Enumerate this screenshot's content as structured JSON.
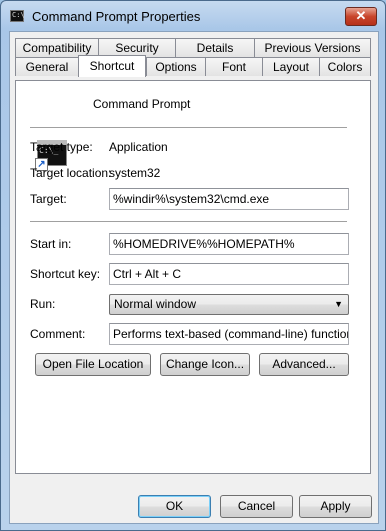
{
  "window": {
    "title": "Command Prompt Properties",
    "close_symbol": "✕"
  },
  "tabs": {
    "row1": [
      "Compatibility",
      "Security",
      "Details",
      "Previous Versions"
    ],
    "row2": [
      "General",
      "Shortcut",
      "Options",
      "Font",
      "Layout",
      "Colors"
    ],
    "active": "Shortcut"
  },
  "shortcut": {
    "name": "Command Prompt",
    "target_type_label": "Target type:",
    "target_type_value": "Application",
    "target_location_label": "Target location:",
    "target_location_value": "system32",
    "target_label": "Target:",
    "target_value": "%windir%\\system32\\cmd.exe",
    "start_in_label": "Start in:",
    "start_in_value": "%HOMEDRIVE%%HOMEPATH%",
    "shortcut_key_label": "Shortcut key:",
    "shortcut_key_value": "Ctrl + Alt + C",
    "run_label": "Run:",
    "run_value": "Normal window",
    "comment_label": "Comment:",
    "comment_value": "Performs text-based (command-line) functions.",
    "open_file_location": "Open File Location",
    "change_icon": "Change Icon...",
    "advanced": "Advanced..."
  },
  "buttons": {
    "ok": "OK",
    "cancel": "Cancel",
    "apply": "Apply"
  }
}
